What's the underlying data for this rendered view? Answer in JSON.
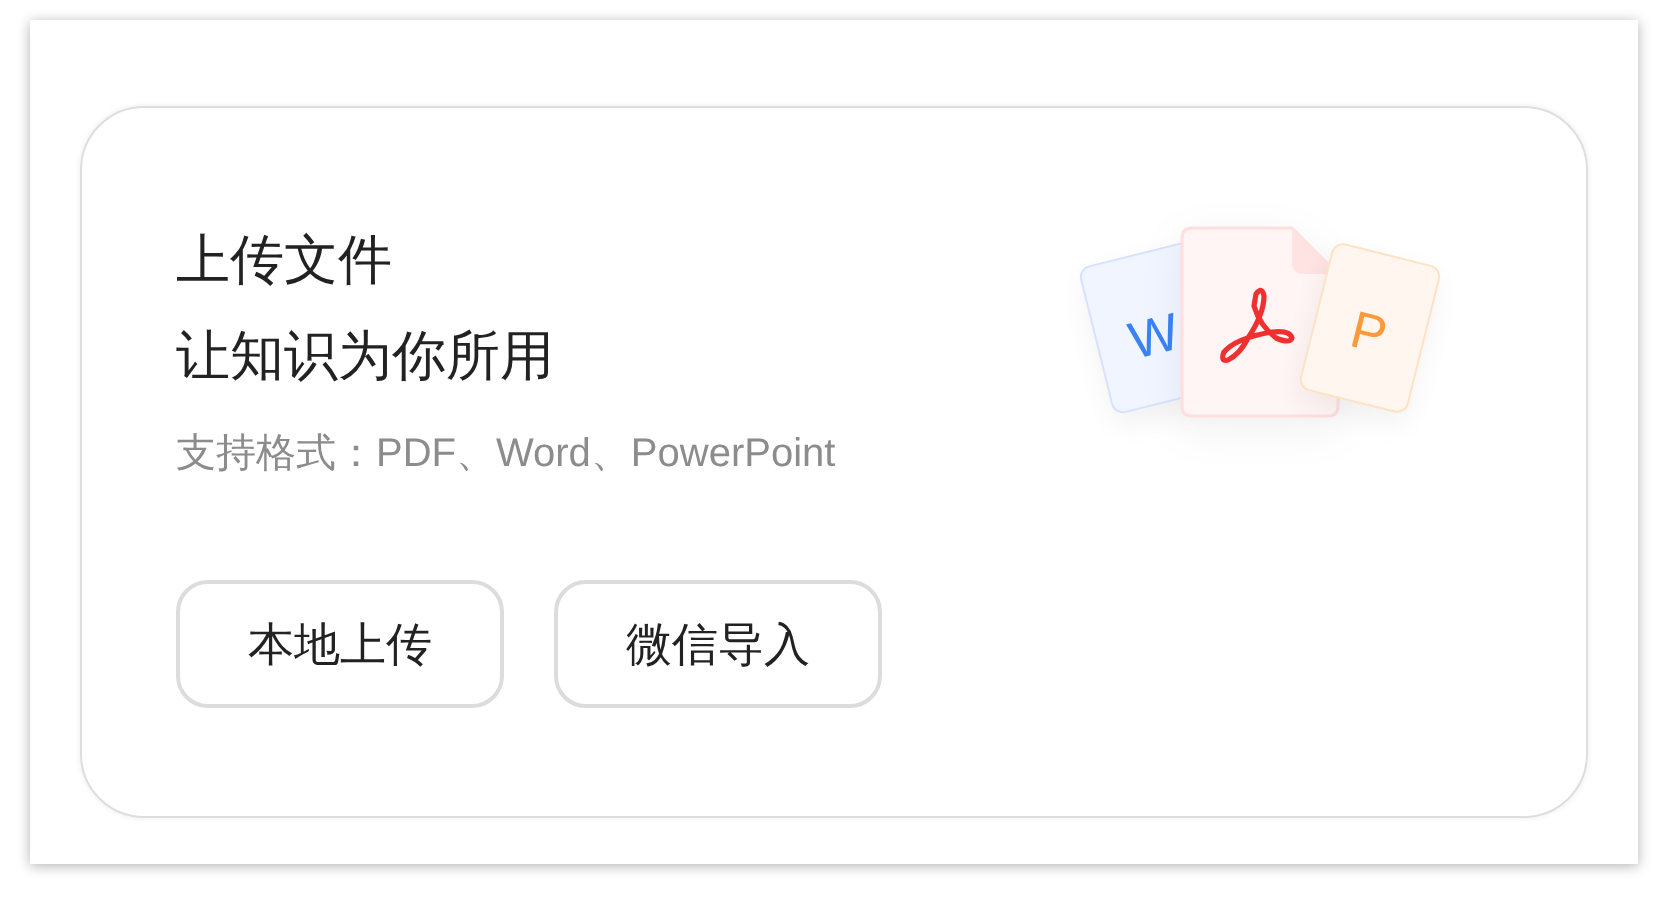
{
  "card": {
    "title_lines": [
      "上传文件",
      "让知识为你所用"
    ],
    "formats": "支持格式：PDF、Word、PowerPoint",
    "file_icons": [
      {
        "kind": "word",
        "letter": "W"
      },
      {
        "kind": "pdf"
      },
      {
        "kind": "powerpoint",
        "letter": "P"
      }
    ],
    "buttons": [
      "本地上传",
      "微信导入"
    ]
  }
}
